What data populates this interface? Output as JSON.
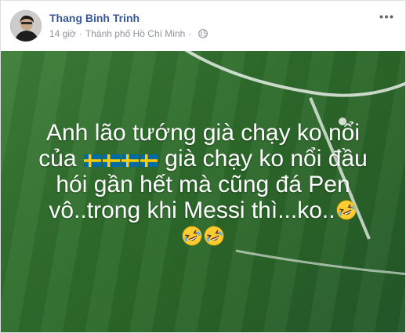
{
  "post": {
    "author": "Thang Binh Trinh",
    "time": "14 giờ",
    "separator": "·",
    "location": "Thành phố Hồ Chí Minh",
    "icons": {
      "privacy": "globe-icon",
      "options": "more-options-icon"
    },
    "caption": {
      "line1": "Anh lão tướng già chạy ko nổi",
      "line2_prefix": "của",
      "line2_suffix": "già chạy ko nổi đầu",
      "line3": "hói gần hết mà cũng đá Pen",
      "line4": "vô..trong khi Messi thì...ko..",
      "flag_emoji": "sweden-flag",
      "laugh_emoji": "rolling-on-floor-laughing"
    },
    "colors": {
      "author": "#385898",
      "meta": "#90949c",
      "background": "#2f6d2c",
      "text": "#ffffff",
      "flag_blue": "#006aa7",
      "flag_yellow": "#fecc00",
      "emoji_face": "#ffcc33"
    }
  }
}
